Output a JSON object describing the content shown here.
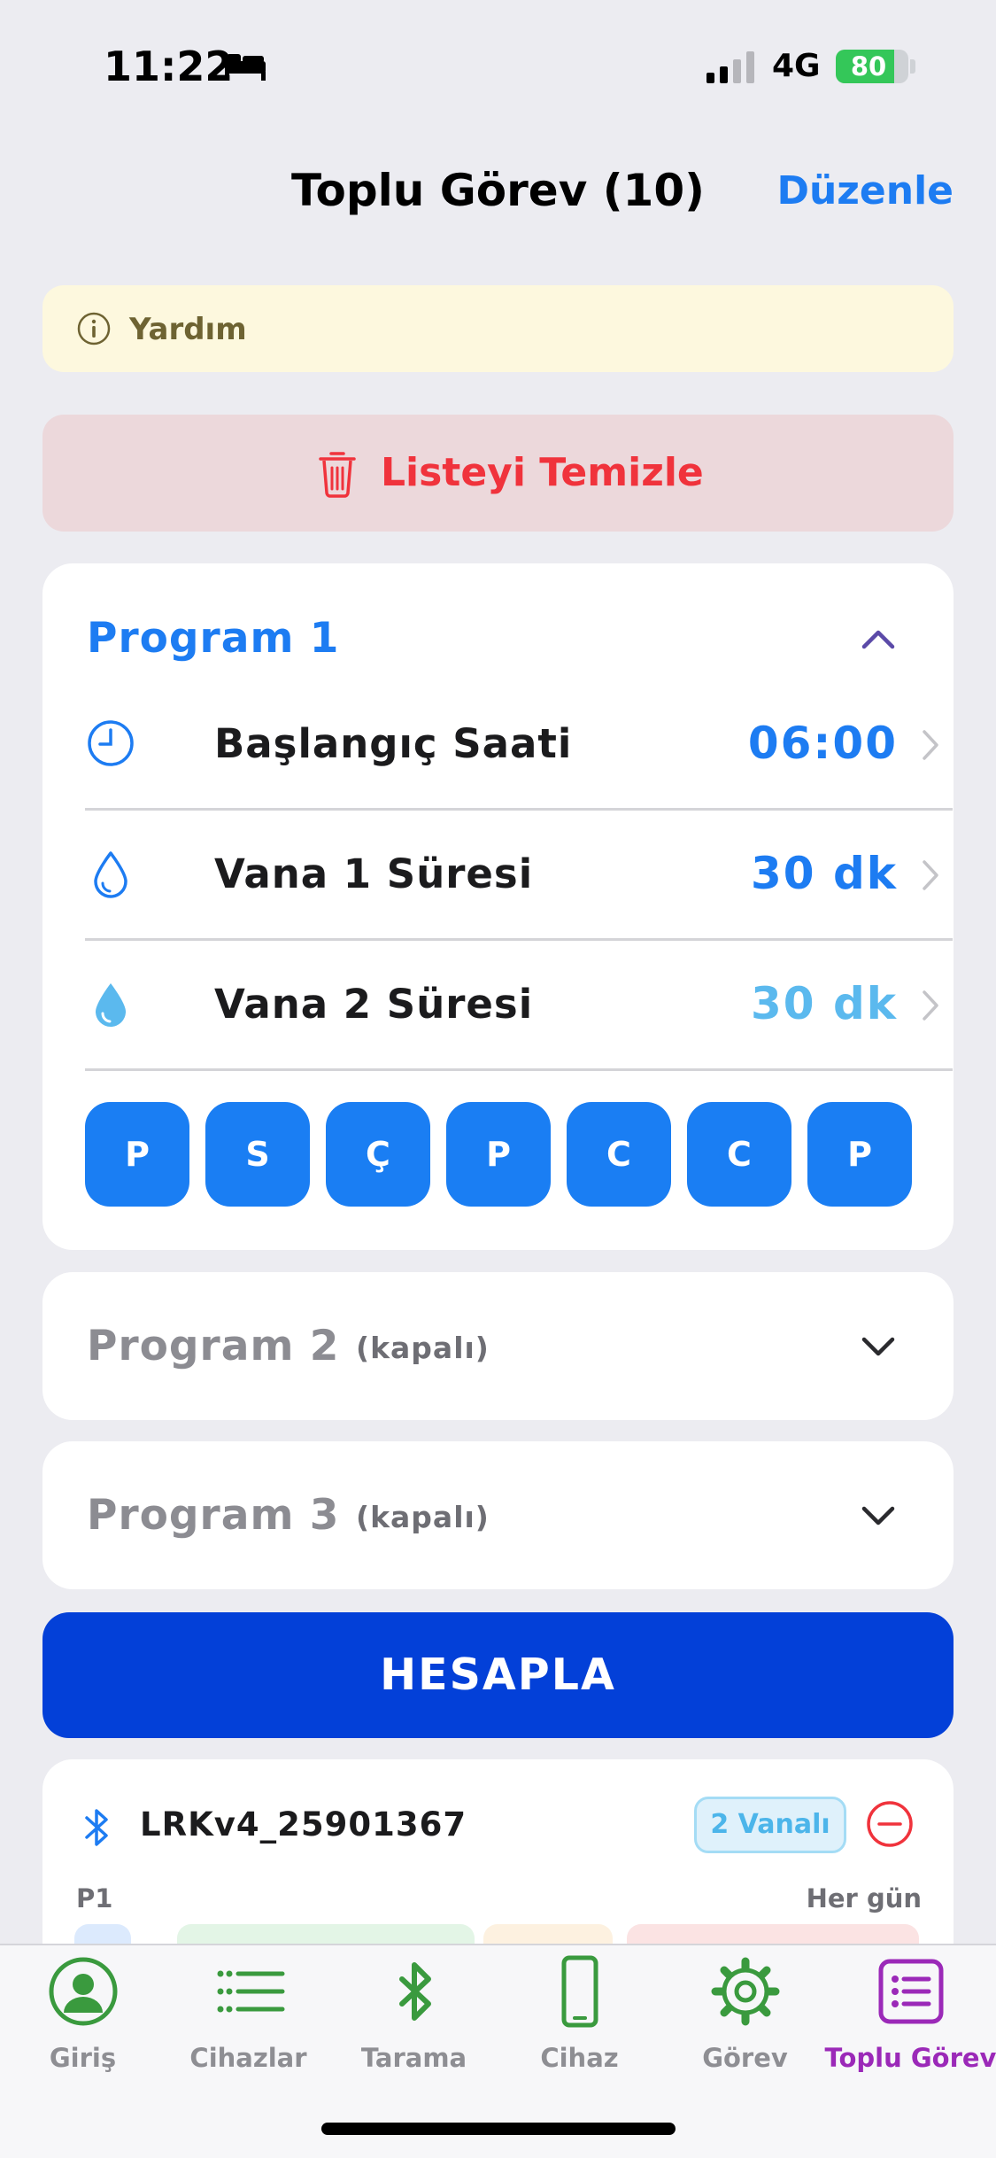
{
  "status_bar": {
    "time": "11:22",
    "network": "4G",
    "battery": "80",
    "battery_fraction": 0.8
  },
  "header": {
    "title": "Toplu Görev (10)",
    "edit_label": "Düzenle"
  },
  "help": {
    "label": "Yardım"
  },
  "clear_list": {
    "label": "Listeyi Temizle"
  },
  "program1": {
    "title": "Program 1",
    "rows": [
      {
        "label": "Başlangıç Saati",
        "value": "06:00",
        "icon": "clock-icon"
      },
      {
        "label": "Vana 1 Süresi",
        "value": "30 dk",
        "icon": "drop-outline-icon"
      },
      {
        "label": "Vana 2 Süresi",
        "value": "30 dk",
        "icon": "drop-filled-icon"
      }
    ],
    "days": [
      "P",
      "S",
      "Ç",
      "P",
      "C",
      "C",
      "P"
    ]
  },
  "program2": {
    "title": "Program 2",
    "status": "(kapalı)"
  },
  "program3": {
    "title": "Program 3",
    "status": "(kapalı)"
  },
  "calculate": {
    "label": "HESAPLA"
  },
  "device": {
    "name": "LRKv4_25901367",
    "badge": "2 Vanalı",
    "program_label": "P1",
    "schedule": "Her gün"
  },
  "tabs": [
    {
      "label": "Giriş",
      "icon": "person-circle-icon",
      "active": false
    },
    {
      "label": "Cihazlar",
      "icon": "list-icon",
      "active": false
    },
    {
      "label": "Tarama",
      "icon": "bluetooth-icon",
      "active": false
    },
    {
      "label": "Cihaz",
      "icon": "phone-icon",
      "active": false
    },
    {
      "label": "Görev",
      "icon": "gear-icon",
      "active": false
    },
    {
      "label": "Toplu Görev",
      "icon": "task-list-icon",
      "active": true
    }
  ],
  "colors": {
    "accent": "#1d7cf2",
    "calculate": "#0340d8",
    "active_tab": "#9b29b8",
    "danger": "#f0333c",
    "green_icon": "#3a9a3e"
  }
}
